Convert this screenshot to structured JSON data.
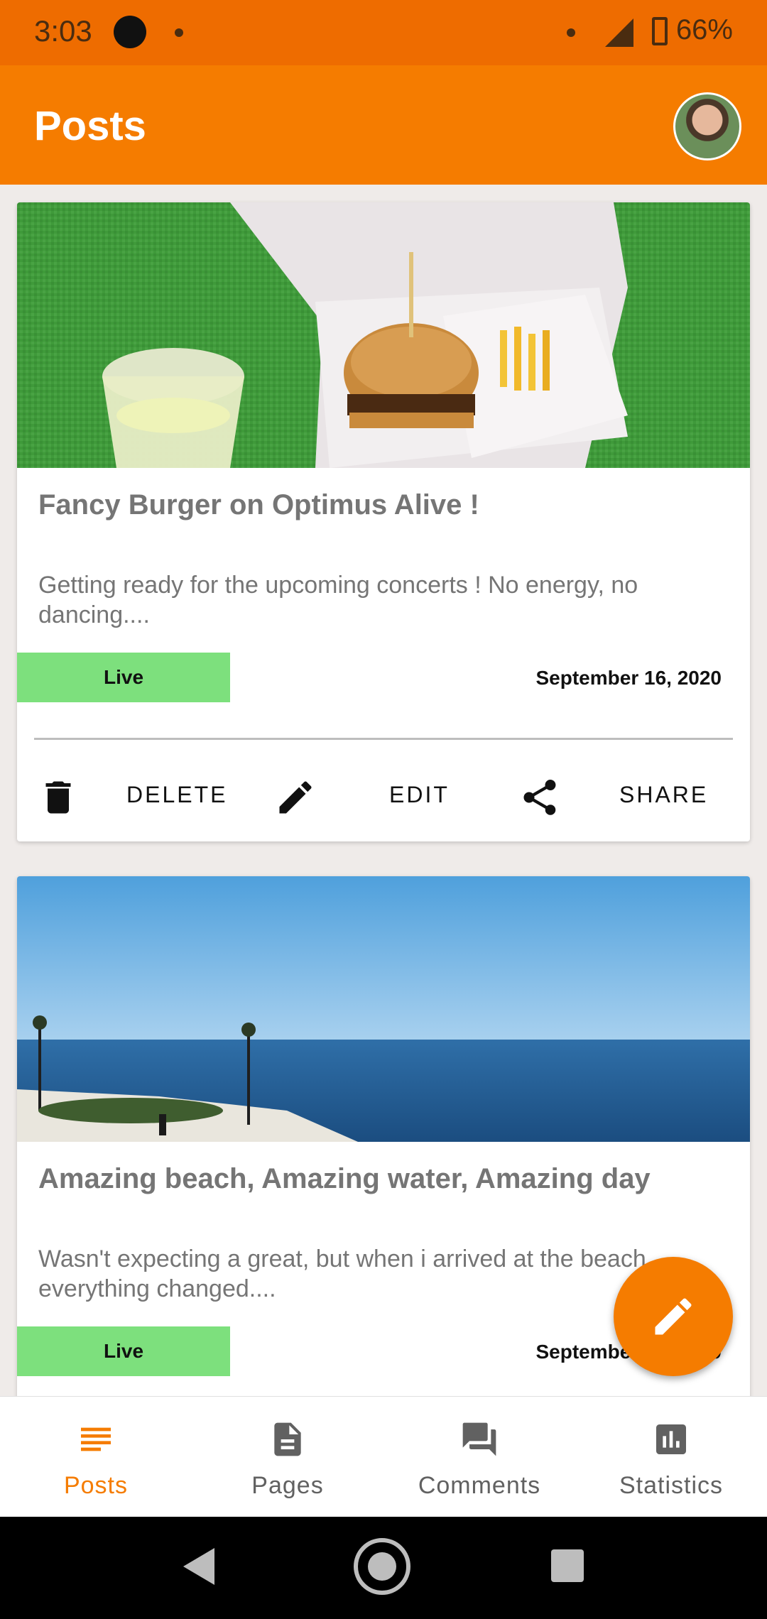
{
  "status_bar": {
    "time": "3:03",
    "battery": "66%"
  },
  "app_bar": {
    "title": "Posts"
  },
  "posts": [
    {
      "title": "Fancy Burger on Optimus Alive !",
      "excerpt": "Getting ready for the upcoming concerts ! No energy, no dancing....",
      "status": "Live",
      "date": "September 16, 2020"
    },
    {
      "title": "Amazing beach, Amazing water, Amazing day",
      "excerpt": "Wasn't expecting a great, but when i arrived at the beach everything changed....",
      "status": "Live",
      "date": "September 16, 2020"
    }
  ],
  "actions": {
    "delete": "DELETE",
    "edit": "EDIT",
    "share": "SHARE"
  },
  "bottom_nav": {
    "items": [
      {
        "label": "Posts",
        "icon": "posts-icon"
      },
      {
        "label": "Pages",
        "icon": "pages-icon"
      },
      {
        "label": "Comments",
        "icon": "comments-icon"
      },
      {
        "label": "Statistics",
        "icon": "statistics-icon"
      }
    ]
  },
  "colors": {
    "primary": "#f57c00",
    "status_bar": "#ee6c00",
    "live_chip": "#7de07d",
    "background": "#efebe9"
  }
}
